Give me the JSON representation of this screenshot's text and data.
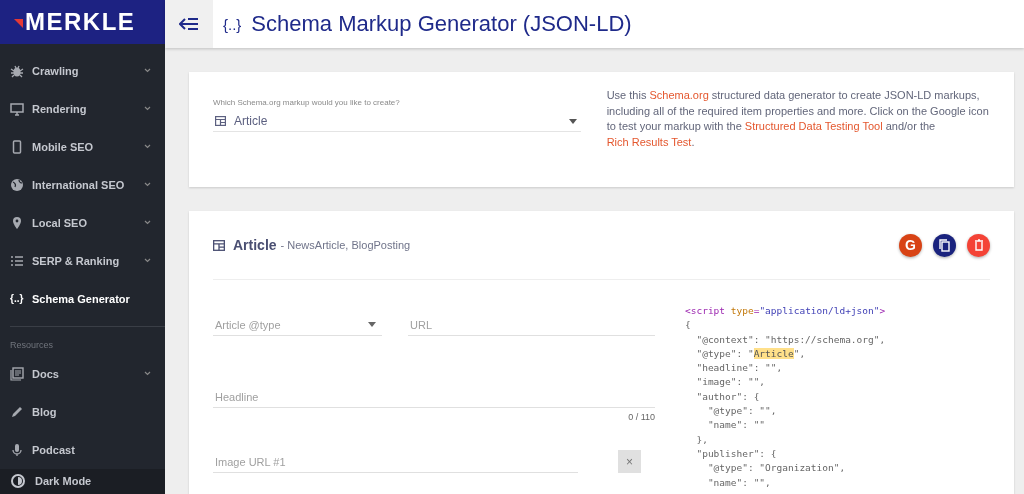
{
  "logo": {
    "text": "MERKLE"
  },
  "header": {
    "title_icon": "{..}",
    "title": "Schema Markup Generator (JSON-LD)"
  },
  "sidebar": {
    "items": [
      {
        "label": "Crawling",
        "expandable": true,
        "selected": false
      },
      {
        "label": "Rendering",
        "expandable": true,
        "selected": false
      },
      {
        "label": "Mobile SEO",
        "expandable": true,
        "selected": false
      },
      {
        "label": "International SEO",
        "expandable": true,
        "selected": false
      },
      {
        "label": "Local SEO",
        "expandable": true,
        "selected": false
      },
      {
        "label": "SERP & Ranking",
        "expandable": true,
        "selected": false
      },
      {
        "label": "Schema Generator",
        "icon_text": "{..}",
        "expandable": false,
        "selected": true
      }
    ],
    "section_label": "Resources",
    "resources": [
      {
        "label": "Docs",
        "expandable": true,
        "selected": false
      },
      {
        "label": "Blog",
        "expandable": false,
        "selected": false
      },
      {
        "label": "Podcast",
        "expandable": false,
        "selected": false
      }
    ],
    "dark_mode": {
      "label": "Dark Mode"
    }
  },
  "type_picker": {
    "label": "Which Schema.org markup would you like to create?",
    "value": "Article"
  },
  "description": [
    {
      "text": "Use this ",
      "link": false
    },
    {
      "text": "Schema.org",
      "link": true
    },
    {
      "text": " structured data generator to create JSON-LD markups, including all of the required item properties and more. Click on the Google icon to test your markup with the ",
      "link": false
    },
    {
      "text": "Structured Data Testing Tool",
      "link": true
    },
    {
      "text": " and/or the ",
      "link": false
    },
    {
      "text": "Rich Results Test",
      "link": true
    },
    {
      "text": ".",
      "link": false
    }
  ],
  "editor": {
    "title": "Article",
    "subtitle": "- NewsArticle, BlogPosting",
    "actions": [
      {
        "kind": "google",
        "label": "G"
      },
      {
        "kind": "copy"
      },
      {
        "kind": "delete"
      }
    ],
    "fields": [
      {
        "kind": "select",
        "placeholder": "Article @type"
      },
      {
        "kind": "text",
        "placeholder": "URL"
      },
      {
        "kind": "text",
        "placeholder": "Headline",
        "counter": "0 / 110"
      },
      {
        "kind": "removable",
        "placeholder": "Image URL #1",
        "remove_label": "×"
      }
    ],
    "code": [
      [
        {
          "text": "<script ",
          "kind": "tag"
        },
        {
          "text": "type",
          "kind": "attr"
        },
        {
          "text": "=",
          "kind": "tag"
        },
        {
          "text": "\"application/ld+json\"",
          "kind": "value"
        },
        {
          "text": ">",
          "kind": "tag"
        }
      ],
      [
        {
          "text": "{",
          "kind": "plain"
        }
      ],
      [
        {
          "text": "  \"@context\": \"https://schema.org\",",
          "kind": "plain"
        }
      ],
      [
        {
          "text": "  \"@type\": \"",
          "kind": "plain"
        },
        {
          "text": "Article",
          "kind": "highlight"
        },
        {
          "text": "\",",
          "kind": "plain"
        }
      ],
      [
        {
          "text": "  \"headline\": \"\",",
          "kind": "plain"
        }
      ],
      [
        {
          "text": "  \"image\": \"\",",
          "kind": "plain"
        }
      ],
      [
        {
          "text": "  \"author\": {",
          "kind": "plain"
        }
      ],
      [
        {
          "text": "    \"@type\": \"\",",
          "kind": "plain"
        }
      ],
      [
        {
          "text": "    \"name\": \"\"",
          "kind": "plain"
        }
      ],
      [
        {
          "text": "  },",
          "kind": "plain"
        }
      ],
      [
        {
          "text": "  \"publisher\": {",
          "kind": "plain"
        }
      ],
      [
        {
          "text": "    \"@type\": \"Organization\",",
          "kind": "plain"
        }
      ],
      [
        {
          "text": "    \"name\": \"\",",
          "kind": "plain"
        }
      ]
    ]
  }
}
